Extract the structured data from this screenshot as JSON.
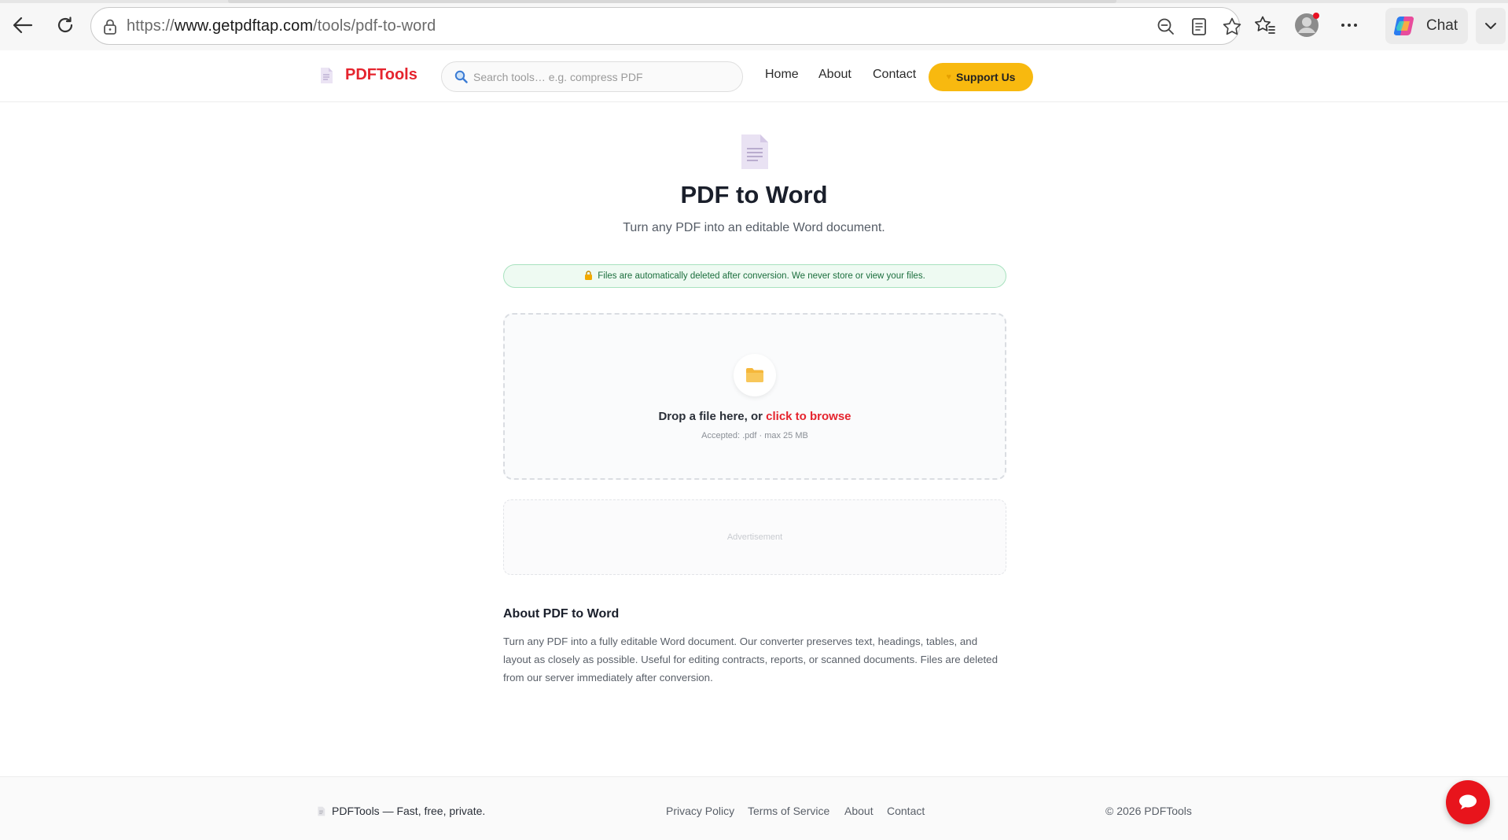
{
  "browser": {
    "url_prefix": "https://",
    "url_domain": "www.getpdftap.com",
    "url_path": "/tools/pdf-to-word",
    "chat_label": "Chat"
  },
  "header": {
    "logo_text": "PDFTools",
    "search_placeholder": "Search tools… e.g. compress PDF",
    "nav": {
      "home": "Home",
      "about": "About",
      "contact": "Contact"
    },
    "support_label": "Support Us"
  },
  "main": {
    "title": "PDF to Word",
    "subtitle": "Turn any PDF into an editable Word document.",
    "notice": "Files are automatically deleted after conversion. We never store or view your files.",
    "drop_text": "Drop a file here, or ",
    "browse_text": "click to browse",
    "accepted": "Accepted: .pdf · max 25 MB",
    "ad_label": "Advertisement",
    "about_heading": "About PDF to Word",
    "about_text": "Turn any PDF into a fully editable Word document. Our converter preserves text, headings, tables, and layout as closely as possible. Useful for editing contracts, reports, or scanned documents. Files are deleted from our server immediately after conversion."
  },
  "footer": {
    "tagline": "PDFTools — Fast, free, private.",
    "links": {
      "privacy": "Privacy Policy",
      "terms": "Terms of Service",
      "about": "About",
      "contact": "Contact"
    },
    "copyright": "© 2026 PDFTools"
  },
  "colors": {
    "brand_red": "#e5242e",
    "support_yellow": "#f8b90f",
    "notice_green": "#1b6e3d"
  }
}
